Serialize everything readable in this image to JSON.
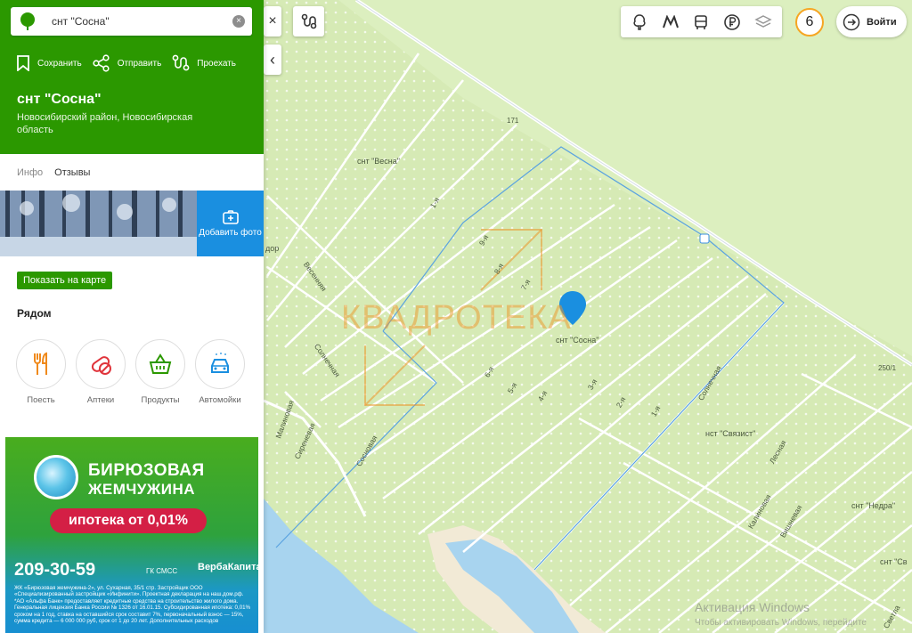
{
  "search": {
    "value": "снт \"Сосна\"",
    "clear_icon": "×"
  },
  "actions": [
    {
      "label": "Сохранить",
      "icon": "bookmark-icon"
    },
    {
      "label": "Отправить",
      "icon": "share-icon"
    },
    {
      "label": "Проехать",
      "icon": "route-icon"
    }
  ],
  "place": {
    "title": "снт \"Сосна\"",
    "subtitle": "Новосибирский район, Новосибирская область"
  },
  "tabs": [
    {
      "label": "Инфо",
      "active": false
    },
    {
      "label": "Отзывы",
      "active": true
    }
  ],
  "add_photo_label": "Добавить фото",
  "show_on_map_label": "Показать на карте",
  "nearby": {
    "title": "Рядом",
    "items": [
      {
        "label": "Поесть",
        "icon": "food-icon"
      },
      {
        "label": "Аптеки",
        "icon": "pharmacy-icon"
      },
      {
        "label": "Продукты",
        "icon": "grocery-icon"
      },
      {
        "label": "Автомойки",
        "icon": "carwash-icon"
      }
    ]
  },
  "ad": {
    "brand_line1": "БИРЮЗОВАЯ",
    "brand_line2": "ЖЕМЧУЖИНА",
    "offer": "ипотека от 0,01%",
    "phone": "209-30-59",
    "developer": "ГК СМСС",
    "bank": "ВербаКапитал",
    "fine_print": "ЖК «Бирюзовая жемчужина-2», ул. Сухарная, 35/1 стр. Застройщик ООО «Специализированный застройщик «Инфинити». Проектная декларация на наш.дом.рф. *АО «Альфа Банк» предоставляет кредитные средства на строительство жилого дома. Генеральная лицензия Банка России № 1326 от 16.01.15. Субсидированная ипотека: 0,01% сроком на 1 год, ставка на оставшийся срок составит 7%, первоначальный взнос — 15%, сумма кредита — 6 000 000 руб, срок от 1 до 20 лет. Дополнительных расходов"
  },
  "map_controls": {
    "close_icon": "×",
    "collapse_icon": "‹",
    "weather_value": "6",
    "login_label": "Войти"
  },
  "map_labels": {
    "snt_vesna": "снт \"Весна\"",
    "snt_sosna": "снт \"Сосна\"",
    "snt_svyazist": "нст \"Связист\"",
    "snt_nedra": "снт \"Недра\"",
    "snt_sv": "снт \"Св",
    "km171": "171",
    "km250": "250/1",
    "dor": "дор",
    "kvadroteka": "КВАДРОТЕКА"
  },
  "streets": [
    {
      "name": "1-я"
    },
    {
      "name": "9-я"
    },
    {
      "name": "8-я"
    },
    {
      "name": "7-я"
    },
    {
      "name": "6-я"
    },
    {
      "name": "5-я"
    },
    {
      "name": "4-я"
    },
    {
      "name": "3-я"
    },
    {
      "name": "2-я"
    },
    {
      "name": "1-я"
    },
    {
      "name": "Весенняя"
    },
    {
      "name": "Солнечная"
    },
    {
      "name": "Малиновая"
    },
    {
      "name": "Сиреневая"
    },
    {
      "name": "Сосновая"
    },
    {
      "name": "Солнечная"
    },
    {
      "name": "Лесная"
    },
    {
      "name": "Калиновая"
    },
    {
      "name": "Вишневая"
    },
    {
      "name": "Светла"
    }
  ],
  "watermark": {
    "line1": "Активация Windows",
    "line2": "Чтобы активировать Windows, перейдите"
  },
  "colors": {
    "brand_green": "#2b9800",
    "accent_blue": "#1a8fe0",
    "marker_blue": "#1a8fe0",
    "map_land": "#dcefbf",
    "water": "#a8d4ef"
  }
}
